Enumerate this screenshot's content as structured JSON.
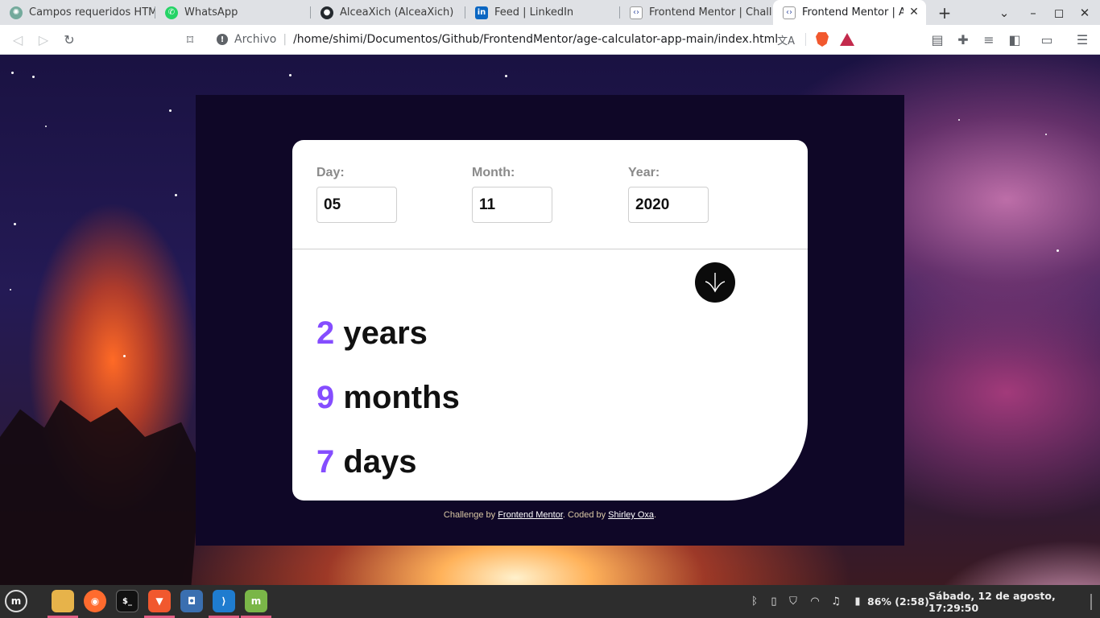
{
  "browser": {
    "tabs": [
      {
        "title": "Campos requeridos HTML.",
        "icon": "chatgpt-icon",
        "color": "#74aa9c"
      },
      {
        "title": "WhatsApp",
        "icon": "whatsapp-icon",
        "color": "#25d366"
      },
      {
        "title": "AlceaXich (AlceaXich)",
        "icon": "github-icon",
        "color": "#24292e"
      },
      {
        "title": "Feed | LinkedIn",
        "icon": "linkedin-icon",
        "color": "#0a66c2"
      },
      {
        "title": "Frontend Mentor | Challen",
        "icon": "frontend-mentor-icon",
        "color": "#3e54a3"
      },
      {
        "title": "Frontend Mentor | Age",
        "icon": "frontend-mentor-icon",
        "color": "#3e54a3"
      }
    ],
    "address": {
      "scheme_label": "Archivo",
      "url": "/home/shimi/Documentos/Github/FrontendMentor/age-calculator-app-main/index.html"
    }
  },
  "app": {
    "day": {
      "label": "Day:",
      "value": "05"
    },
    "month": {
      "label": "Month:",
      "value": "11"
    },
    "year": {
      "label": "Year:",
      "value": "2020"
    },
    "results": {
      "years": {
        "num": "2",
        "unit": "years"
      },
      "months": {
        "num": "9",
        "unit": "months"
      },
      "days": {
        "num": "7",
        "unit": "days"
      }
    },
    "accent_color": "#854dff",
    "attribution": {
      "prefix": "Challenge by",
      "link1": "Frontend Mentor",
      "middle": ". Coded by",
      "link2": "Shirley Oxa",
      "suffix": "."
    }
  },
  "taskbar": {
    "apps": [
      "menu-icon",
      "files-icon",
      "firefox-icon",
      "terminal-icon",
      "brave-icon",
      "screenshot-icon",
      "vscode-icon",
      "software-manager-icon"
    ],
    "battery": "86% (2:58)",
    "datetime": "Sábado, 12 de agosto, 17:29:50"
  }
}
